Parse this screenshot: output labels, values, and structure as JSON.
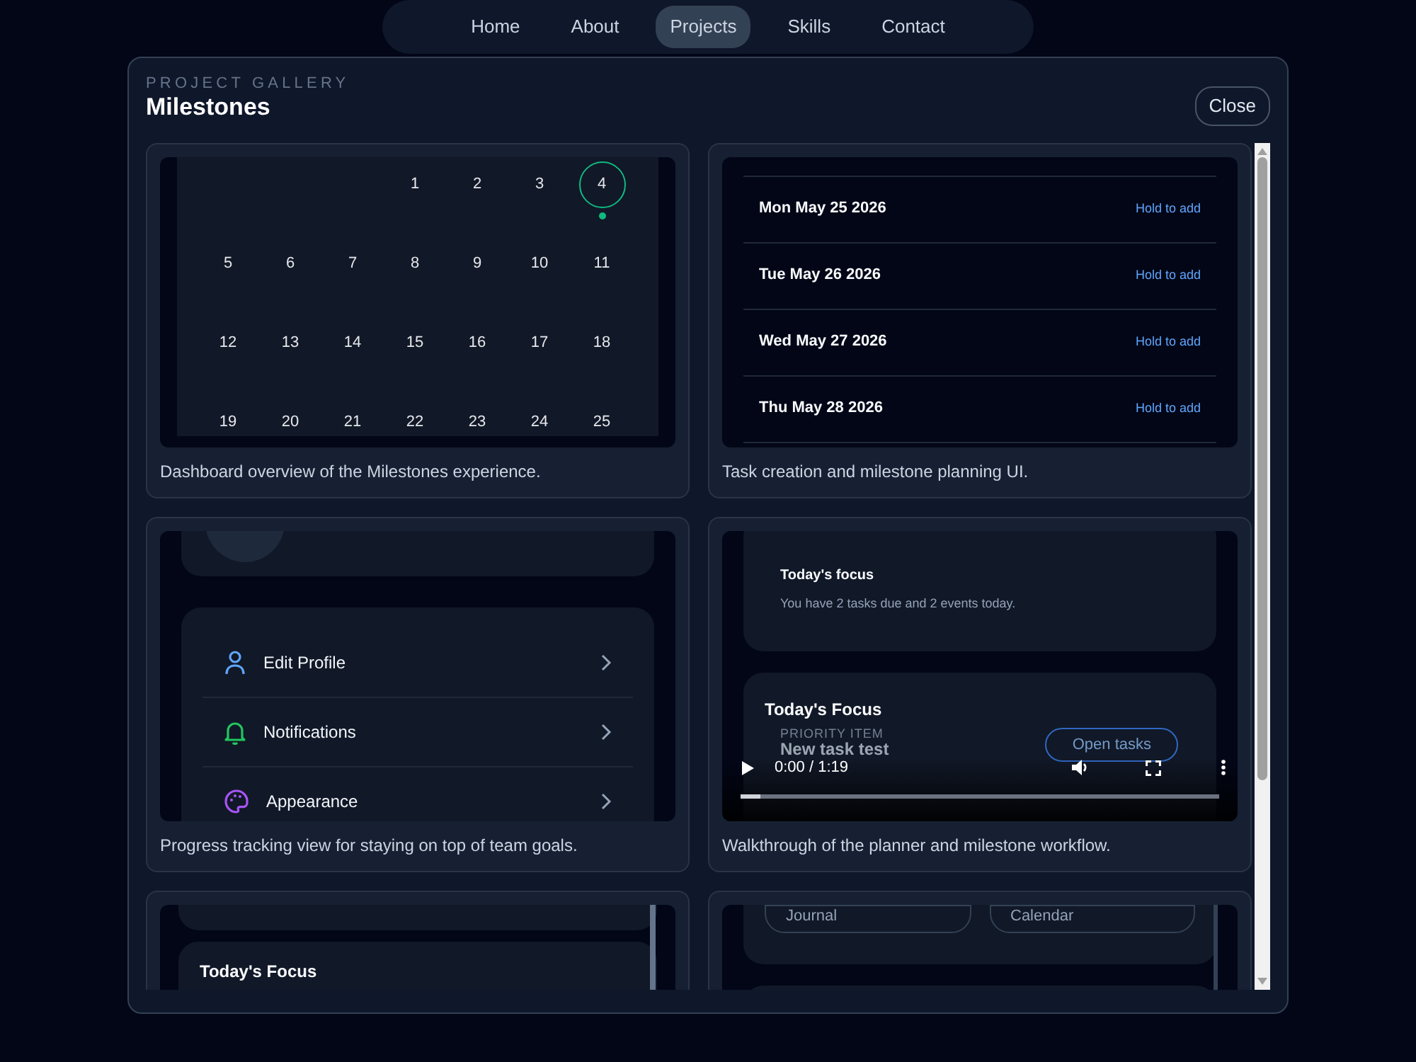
{
  "nav": {
    "items": [
      {
        "label": "Home",
        "selected": false
      },
      {
        "label": "About",
        "selected": false
      },
      {
        "label": "Projects",
        "selected": true
      },
      {
        "label": "Skills",
        "selected": false
      },
      {
        "label": "Contact",
        "selected": false
      }
    ]
  },
  "modal": {
    "eyebrow": "PROJECT GALLERY",
    "title": "Milestones",
    "close_label": "Close"
  },
  "gallery": [
    {
      "kind": "calendar",
      "caption": "Dashboard overview of the Milestones experience.",
      "weeks": [
        [
          {
            "kind": "blank"
          },
          {
            "kind": "blank"
          },
          {
            "kind": "blank"
          },
          {
            "kind": "day",
            "label": "1",
            "selected": false,
            "has_event": false
          },
          {
            "kind": "day",
            "label": "2",
            "selected": false,
            "has_event": false
          },
          {
            "kind": "day",
            "label": "3",
            "selected": false,
            "has_event": false
          },
          {
            "kind": "day",
            "label": "4",
            "selected": true,
            "has_event": true
          }
        ],
        [
          {
            "kind": "day",
            "label": "5",
            "selected": false,
            "has_event": false
          },
          {
            "kind": "day",
            "label": "6",
            "selected": false,
            "has_event": false
          },
          {
            "kind": "day",
            "label": "7",
            "selected": false,
            "has_event": false
          },
          {
            "kind": "day",
            "label": "8",
            "selected": false,
            "has_event": false
          },
          {
            "kind": "day",
            "label": "9",
            "selected": false,
            "has_event": false
          },
          {
            "kind": "day",
            "label": "10",
            "selected": false,
            "has_event": false
          },
          {
            "kind": "day",
            "label": "11",
            "selected": false,
            "has_event": false
          }
        ],
        [
          {
            "kind": "day",
            "label": "12",
            "selected": false,
            "has_event": false
          },
          {
            "kind": "day",
            "label": "13",
            "selected": false,
            "has_event": false
          },
          {
            "kind": "day",
            "label": "14",
            "selected": false,
            "has_event": false
          },
          {
            "kind": "day",
            "label": "15",
            "selected": false,
            "has_event": false
          },
          {
            "kind": "day",
            "label": "16",
            "selected": false,
            "has_event": false
          },
          {
            "kind": "day",
            "label": "17",
            "selected": false,
            "has_event": false
          },
          {
            "kind": "day",
            "label": "18",
            "selected": false,
            "has_event": false
          }
        ],
        [
          {
            "kind": "day",
            "label": "19",
            "selected": false,
            "has_event": false
          },
          {
            "kind": "day",
            "label": "20",
            "selected": false,
            "has_event": false
          },
          {
            "kind": "day",
            "label": "21",
            "selected": false,
            "has_event": false
          },
          {
            "kind": "day",
            "label": "22",
            "selected": false,
            "has_event": false
          },
          {
            "kind": "day",
            "label": "23",
            "selected": false,
            "has_event": false
          },
          {
            "kind": "day",
            "label": "24",
            "selected": false,
            "has_event": false
          },
          {
            "kind": "day",
            "label": "25",
            "selected": false,
            "has_event": false
          }
        ]
      ]
    },
    {
      "kind": "day_list",
      "caption": "Task creation and milestone planning UI.",
      "days": [
        {
          "date": "Mon May 25 2026",
          "action": "Hold to add"
        },
        {
          "date": "Tue May 26 2026",
          "action": "Hold to add"
        },
        {
          "date": "Wed May 27 2026",
          "action": "Hold to add"
        },
        {
          "date": "Thu May 28 2026",
          "action": "Hold to add"
        }
      ]
    },
    {
      "kind": "settings",
      "caption": "Progress tracking view for staying on top of team goals.",
      "items": [
        {
          "label": "Edit Profile",
          "color": "#60a5fa"
        },
        {
          "label": "Notifications",
          "color": "#22c55e"
        },
        {
          "label": "Appearance",
          "color": "#a855f7"
        }
      ]
    },
    {
      "kind": "video",
      "caption": "Walkthrough of the planner and milestone workflow.",
      "focus_card": {
        "title": "Today's focus",
        "text": "You have 2 tasks due and 2 events today."
      },
      "focus_section": {
        "title": "Today's Focus",
        "eyebrow": "PRIORITY ITEM",
        "task": "New task test",
        "button": "Open tasks"
      },
      "player": {
        "time": "0:00 / 1:19",
        "level": 0.04
      }
    },
    {
      "kind": "focus",
      "panel_title": "Today's Focus"
    },
    {
      "kind": "shortcuts",
      "buttons": [
        "Journal",
        "Calendar"
      ]
    }
  ]
}
